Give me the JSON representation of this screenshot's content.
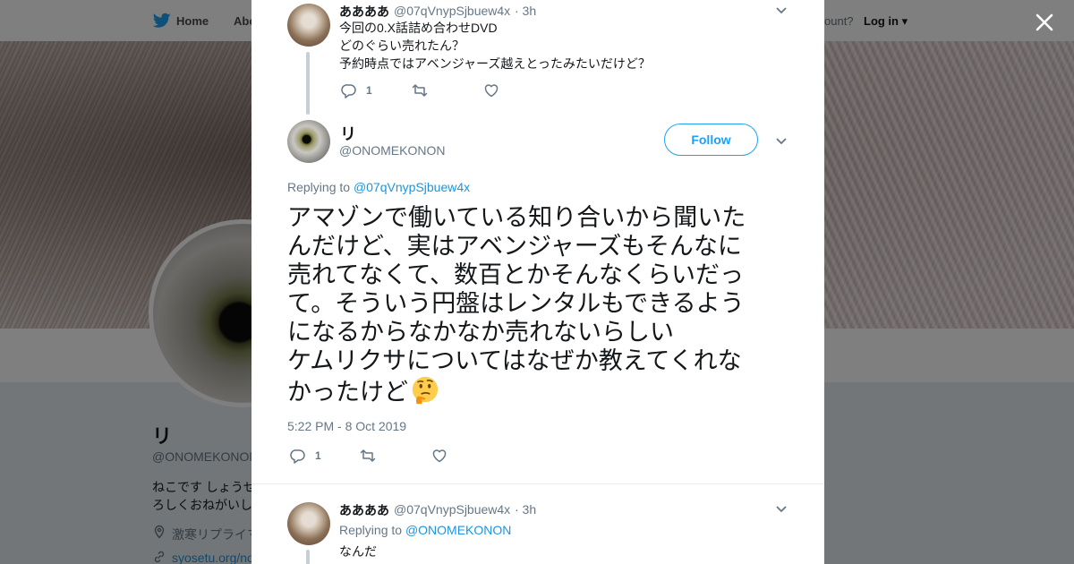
{
  "background": {
    "nav": {
      "home": "Home",
      "about": "Abo",
      "have_account": "ccount?",
      "login": "Log in"
    },
    "profile": {
      "name": "リ",
      "handle": "@ONOMEKONON",
      "bio_line1": "ねこです しょうせ",
      "bio_line2": "ろしくおねがいし",
      "location": "激寒リプライマ",
      "link": "syosetu.org/no"
    }
  },
  "modal": {
    "close_icon": "close-icon",
    "parent_tweet": {
      "name": "ああああ",
      "handle": "@07qVnypSjbuew4x",
      "time": "· 3h",
      "lines": [
        "今回の0.X話詰め合わせDVD",
        "どのぐらい売れたん？",
        "予約時点ではアベンジャーズ越えとったみたいだけど？"
      ],
      "reply_count": "1"
    },
    "main_tweet": {
      "name": "リ",
      "handle": "@ONOMEKONON",
      "follow_label": "Follow",
      "replying_label": "Replying to",
      "replying_to": "@07qVnypSjbuew4x",
      "lines": [
        "アマゾンで働いている知り合いから聞いた",
        "んだけど、実はアベンジャーズもそんなに",
        "売れてなくて、数百とかそんなくらいだっ",
        "て。そういう円盤はレンタルもできるよう",
        "になるからなかなか売れないらしい",
        "ケムリクサについてはなぜか教えてくれな",
        "かったけど"
      ],
      "emoji": "thinking-face",
      "timestamp": "5:22 PM - 8 Oct 2019",
      "reply_count": "1"
    },
    "reply_tweet": {
      "name": "ああああ",
      "handle": "@07qVnypSjbuew4x",
      "time": "· 3h",
      "replying_label": "Replying to",
      "replying_to": "@ONOMEKONON",
      "line1": "なんだ"
    }
  },
  "colors": {
    "accent": "#1da1f2",
    "link": "#1b95e0",
    "muted": "#657786",
    "text": "#14171a",
    "thread_line": "#c4cfd6"
  }
}
